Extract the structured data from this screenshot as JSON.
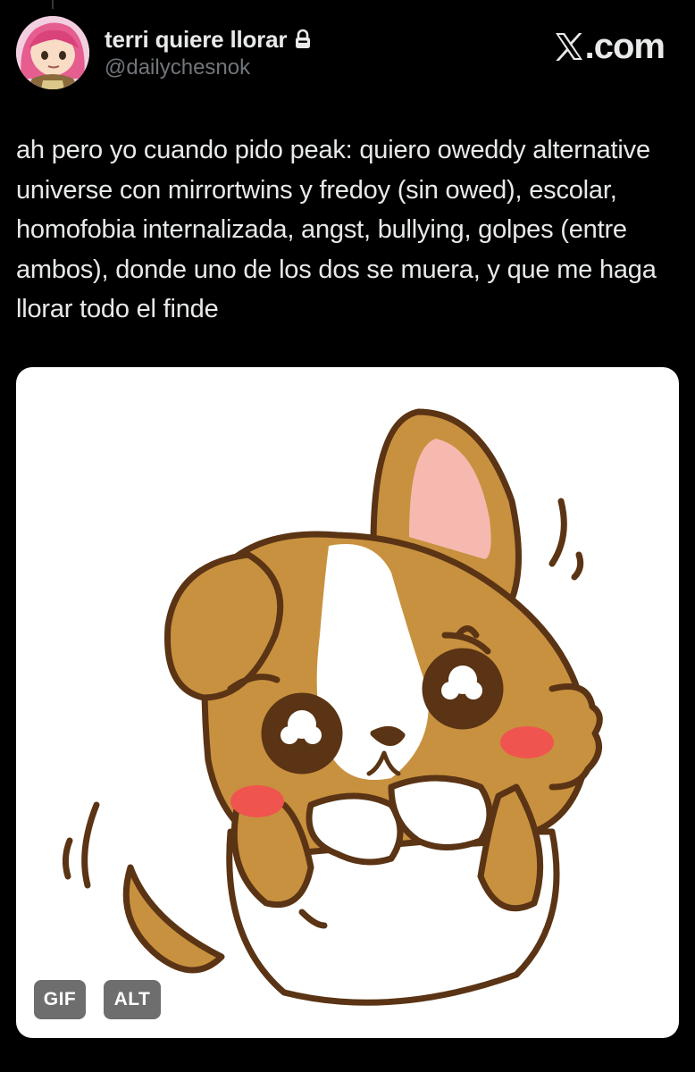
{
  "user": {
    "display_name": "terri quiere llorar",
    "handle": "@dailychesnok",
    "protected_icon": "lock-icon",
    "avatar_icon": "anime-avatar"
  },
  "brand": {
    "icon": "x-logo-icon",
    "suffix": ".com"
  },
  "tweet": {
    "text": "ah pero yo cuando pido peak: quiero oweddy alternative universe con mirrortwins y fredoy (sin owed), escolar, homofobia internalizada, angst, bullying, golpes (entre ambos), donde uno de los dos se muera, y que me haga llorar todo el finde"
  },
  "media": {
    "image_icon": "crying-puppy-illustration",
    "badges": {
      "gif_label": "GIF",
      "alt_label": "ALT"
    }
  },
  "colors": {
    "background": "#000000",
    "text_primary": "#e7e9ea",
    "text_secondary": "#71767b",
    "dog_fur": "#c8913f",
    "dog_outline": "#5a3414",
    "blush": "#f0544f",
    "inner_ear": "#f6b9b0",
    "badge_bg": "#6e6e6e"
  }
}
